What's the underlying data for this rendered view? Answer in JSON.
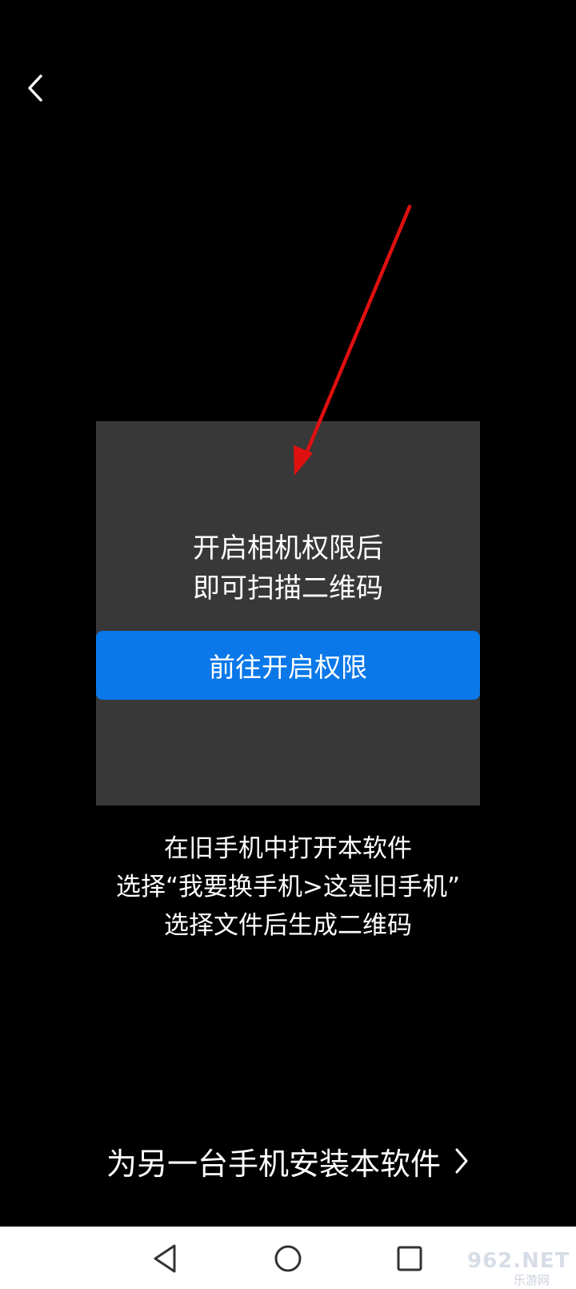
{
  "header": {
    "back_icon": "chevron-left-icon"
  },
  "scanner": {
    "permission_line1": "开启相机权限后",
    "permission_line2": "即可扫描二维码",
    "button_label": "前往开启权限"
  },
  "instructions": {
    "line1": "在旧手机中打开本软件",
    "line2": "选择“我要换手机>这是旧手机”",
    "line3": "选择文件后生成二维码"
  },
  "footer": {
    "install_label": "为另一台手机安装本软件",
    "chevron_icon": "chevron-right-icon"
  },
  "navbar": {
    "back_icon": "triangle-back-icon",
    "home_icon": "circle-home-icon",
    "recent_icon": "square-recent-icon"
  },
  "watermark": {
    "brand": "962.NET",
    "subtitle": "乐游网"
  },
  "colors": {
    "background": "#000000",
    "scan_area": "#383838",
    "button_blue": "#0a78e8",
    "arrow_red": "#e01010",
    "nav_bar": "#ffffff"
  }
}
